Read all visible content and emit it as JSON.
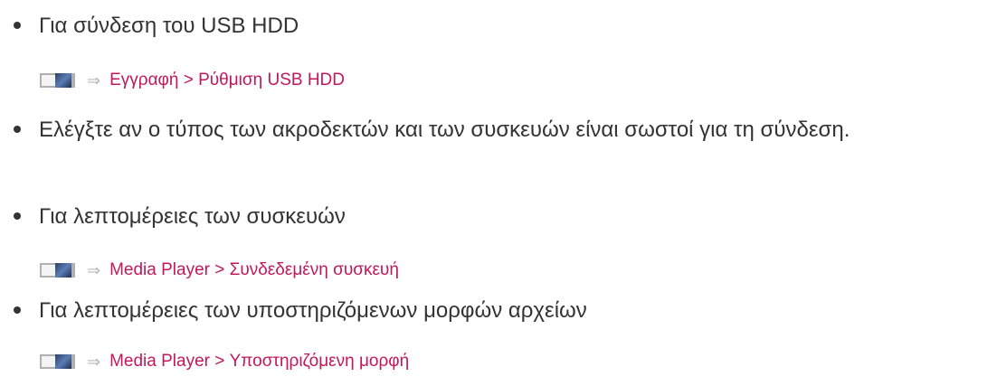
{
  "items": [
    {
      "text": "Για σύνδεση του USB HDD",
      "path": {
        "icon": "menu-tv-icon",
        "arrow": "⇒",
        "text": "Εγγραφή > Ρύθμιση USB HDD"
      }
    },
    {
      "text": "Ελέγξτε αν ο τύπος των ακροδεκτών και των συσκευών είναι σωστοί για τη σύνδεση."
    },
    {
      "text": "Για λεπτομέρειες των συσκευών",
      "path": {
        "icon": "menu-tv-icon",
        "arrow": "⇒",
        "text": "Media Player > Συνδεδεμένη συσκευή"
      }
    },
    {
      "text": "Για λεπτομέρειες των υποστηριζόμενων μορφών αρχείων",
      "path": {
        "icon": "menu-tv-icon",
        "arrow": "⇒",
        "text": "Media Player > Υποστηριζόμενη μορφή"
      }
    }
  ],
  "colors": {
    "body_text": "#333333",
    "link_text": "#c2185b",
    "arrow": "#b8b8b8"
  }
}
